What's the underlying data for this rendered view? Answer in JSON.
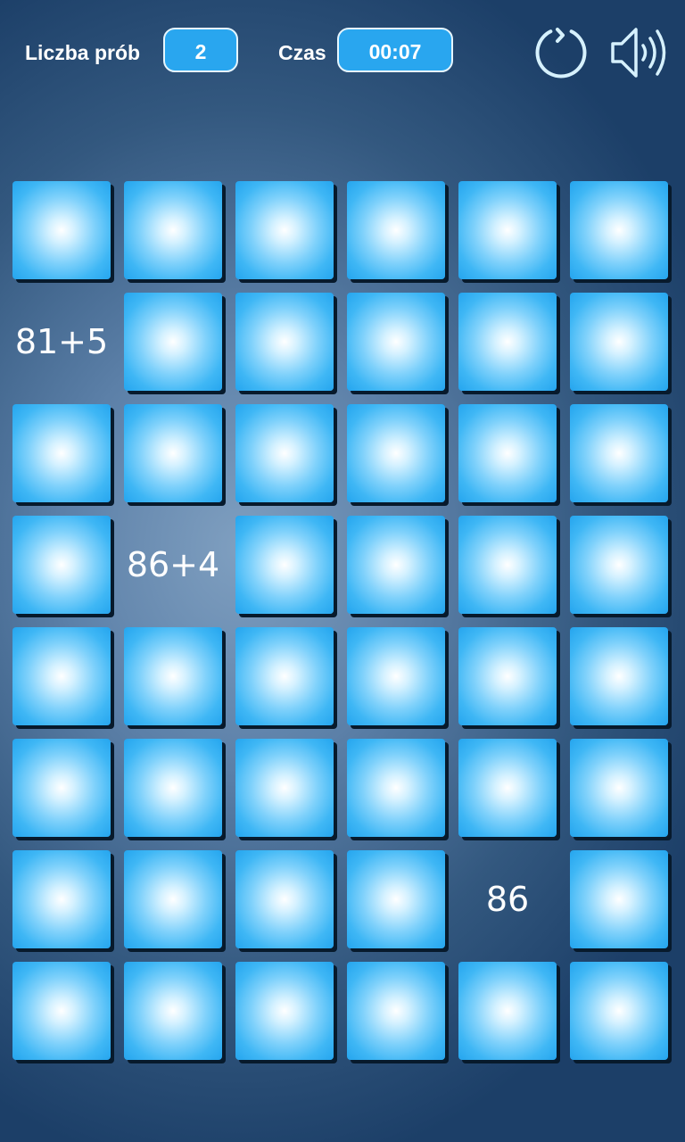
{
  "header": {
    "attempts_label": "Liczba prób",
    "attempts_value": "2",
    "time_label": "Czas",
    "time_value": "00:07",
    "restart_icon": "restart-icon",
    "sound_icon": "speaker-icon"
  },
  "board": {
    "columns": 6,
    "rows": 8,
    "tiles": [
      "",
      "",
      "",
      "",
      "",
      "",
      "81+5",
      "",
      "",
      "",
      "",
      "",
      "",
      "",
      "",
      "",
      "",
      "",
      "",
      "86+4",
      "",
      "",
      "",
      "",
      "",
      "",
      "",
      "",
      "",
      "",
      "",
      "",
      "",
      "",
      "",
      "",
      "",
      "",
      "",
      "",
      "86",
      "",
      "",
      "",
      "",
      "",
      "",
      ""
    ]
  },
  "colors": {
    "tile_face": "#29a6ef",
    "tile_glow": "#ffffff",
    "pill_fill": "#29a6ef",
    "pill_border": "#e6f6ff",
    "background_center": "#7f9fc0",
    "background_edge": "#1c3f68",
    "icon_stroke": "#d6f1fd"
  }
}
